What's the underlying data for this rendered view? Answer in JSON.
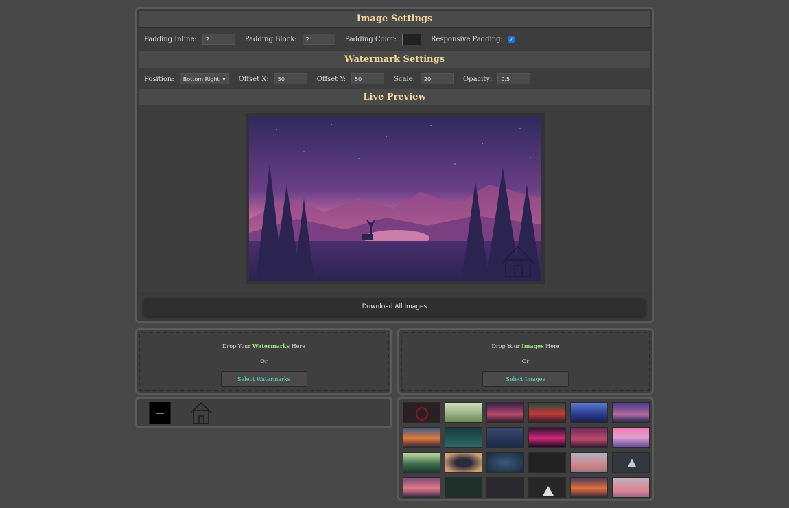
{
  "image_settings": {
    "title": "Image Settings",
    "padding_inline_label": "Padding Inline:",
    "padding_inline_value": "2",
    "padding_block_label": "Padding Block:",
    "padding_block_value": "2",
    "padding_color_label": "Padding Color:",
    "padding_color_value": "#222222",
    "responsive_padding_label": "Responsive Padding:",
    "responsive_padding_checked": true
  },
  "watermark_settings": {
    "title": "Watermark Settings",
    "position_label": "Position:",
    "position_value": "Bottom Right",
    "offset_x_label": "Offset X:",
    "offset_x_value": "50",
    "offset_y_label": "Offset Y:",
    "offset_y_value": "50",
    "scale_label": "Scale:",
    "scale_value": "20",
    "opacity_label": "Opacity:",
    "opacity_value": "0.5"
  },
  "live_preview": {
    "title": "Live Preview",
    "watermark_icon": "house-icon"
  },
  "download_button": "Download All Images",
  "watermark_drop": {
    "title_prefix": "Drop Your",
    "title_highlight": "Watermarks",
    "title_suffix": "Here",
    "or": "Or",
    "button": "Select Watermarks",
    "items": [
      "dark-square-watermark",
      "house-icon"
    ]
  },
  "image_drop": {
    "title_prefix": "Drop Your",
    "title_highlight": "Images",
    "title_suffix": "Here",
    "or": "Or",
    "button": "Select Images"
  },
  "colors": {
    "header_text": "#f2d79a",
    "highlight_green": "#9be07a",
    "button_text": "#5fe0c8",
    "checkbox": "#1a73e8"
  }
}
